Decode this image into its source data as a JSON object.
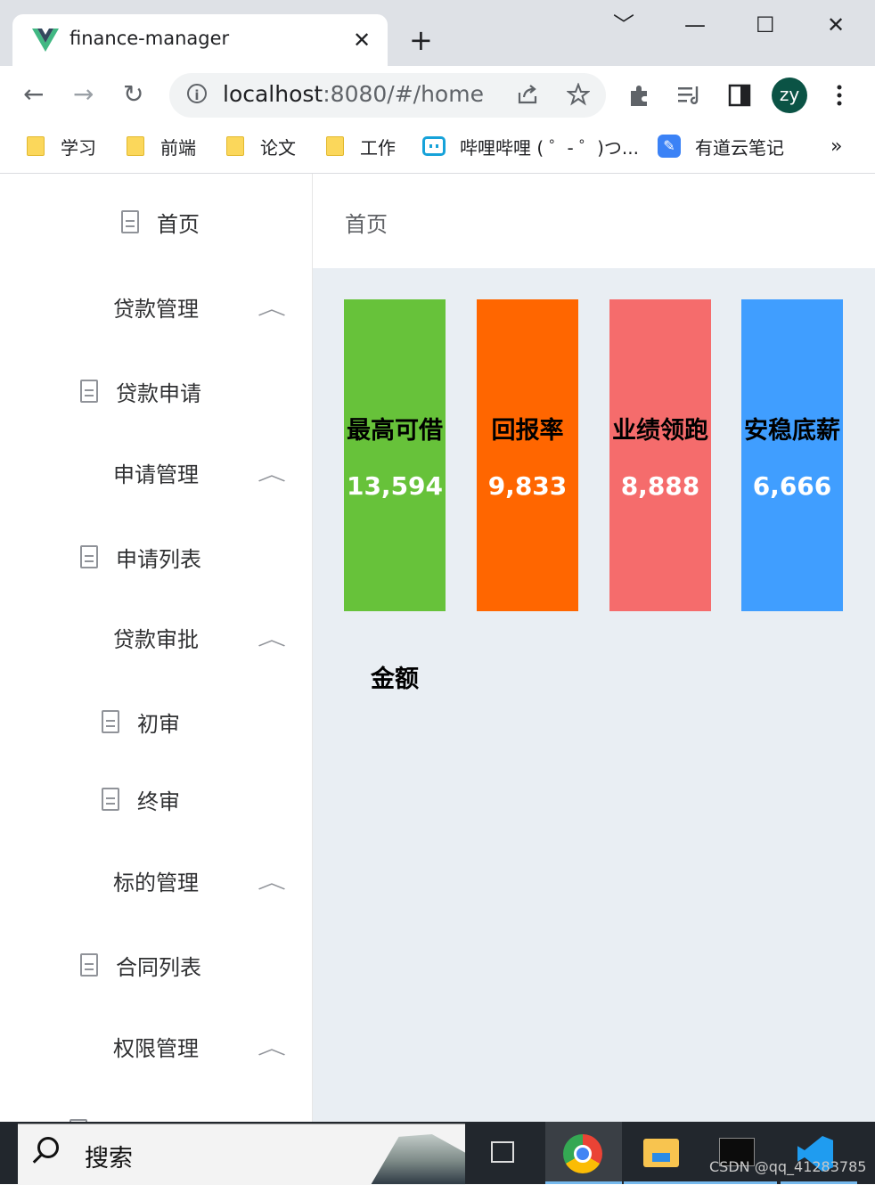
{
  "browser": {
    "tab_title": "finance-manager",
    "tab_close": "✕",
    "new_tab": "+",
    "url_host": "localhost",
    "url_rest": ":8080/#/home",
    "profile_initials": "zy",
    "window_controls": {
      "chevron": "﹀",
      "minimize": "—",
      "maximize": "☐",
      "close": "✕"
    },
    "nav": {
      "back": "←",
      "forward": "→",
      "reload": "↻"
    },
    "toolbar_icons": [
      "share-icon",
      "star-icon",
      "extensions-icon",
      "reading-list-icon",
      "sidebar-icon",
      "menu-icon"
    ],
    "bookmarks": [
      {
        "label": "学习",
        "icon": "folder-icon"
      },
      {
        "label": "前端",
        "icon": "folder-icon"
      },
      {
        "label": "论文",
        "icon": "folder-icon"
      },
      {
        "label": "工作",
        "icon": "folder-icon"
      },
      {
        "label": "哔哩哔哩 ( ゜- ゜)つ...",
        "icon": "bilibili-icon"
      },
      {
        "label": "有道云笔记",
        "icon": "youdao-note-icon"
      }
    ],
    "bookmarks_more": "»"
  },
  "sidebar": {
    "items": [
      {
        "label": "首页",
        "type": "item"
      },
      {
        "label": "贷款管理",
        "type": "group"
      },
      {
        "label": "贷款申请",
        "type": "item"
      },
      {
        "label": "申请管理",
        "type": "group"
      },
      {
        "label": "申请列表",
        "type": "item"
      },
      {
        "label": "贷款审批",
        "type": "group"
      },
      {
        "label": "初审",
        "type": "item"
      },
      {
        "label": "终审",
        "type": "item"
      },
      {
        "label": "标的管理",
        "type": "group"
      },
      {
        "label": "合同列表",
        "type": "item"
      },
      {
        "label": "权限管理",
        "type": "group"
      }
    ],
    "chevron": "︿"
  },
  "header": {
    "title": "首页"
  },
  "cards": [
    {
      "label": "最高可借",
      "value": "13,594",
      "color": "#67c23a"
    },
    {
      "label": "回报率",
      "value": "9,833",
      "color": "#ff6600"
    },
    {
      "label": "业绩领跑",
      "value": "8,888",
      "color": "#f56c6c"
    },
    {
      "label": "安稳底薪",
      "value": "6,666",
      "color": "#409eff"
    }
  ],
  "amount_label": "金额",
  "taskbar": {
    "search_text": "搜索",
    "watermark": "CSDN @qq_41283785"
  }
}
